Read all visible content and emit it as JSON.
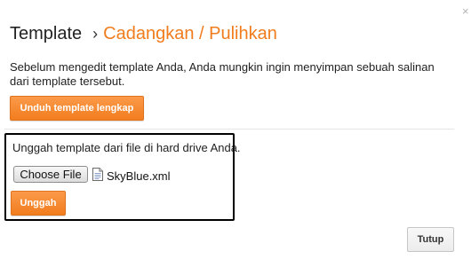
{
  "dialog": {
    "close_glyph": "×",
    "title": "Template",
    "separator": "›",
    "subtitle": "Cadangkan / Pulihkan",
    "description": "Sebelum mengedit template Anda, Anda mungkin ingin menyimpan sebuah salinan dari template tersebut.",
    "download_button": "Unduh template lengkap",
    "upload_section": {
      "instruction": "Unggah template dari file di hard drive Anda.",
      "choose_file_button": "Choose File",
      "file_icon": "document-icon",
      "selected_file": "SkyBlue.xml",
      "upload_button": "Unggah"
    },
    "close_button": "Tutup"
  },
  "colors": {
    "accent": "#f07c1d",
    "button_orange": "#f27d1e",
    "highlight_border": "#000000"
  }
}
